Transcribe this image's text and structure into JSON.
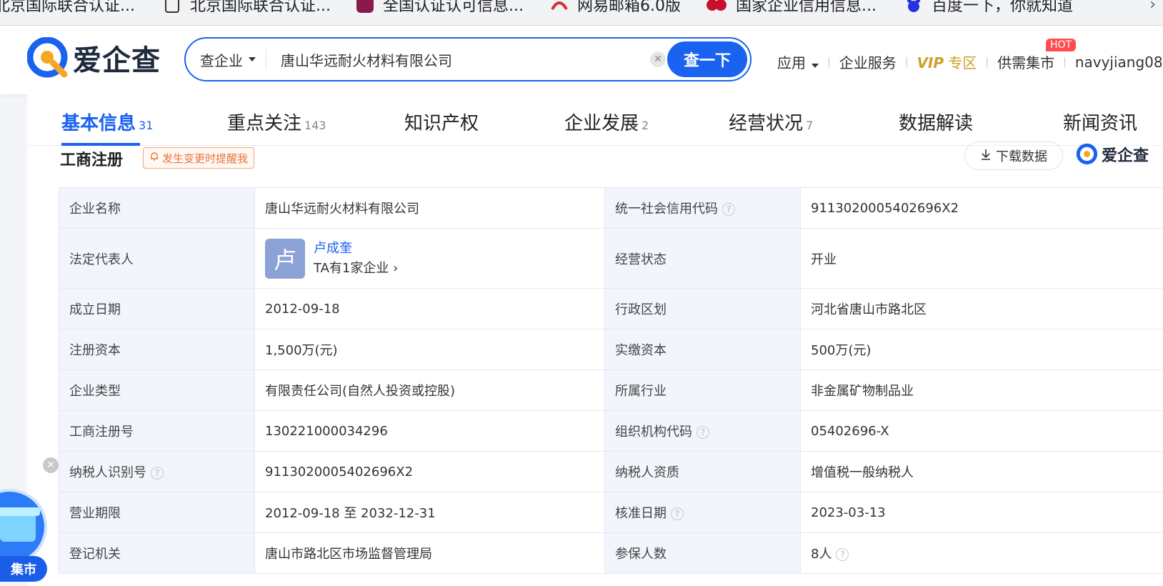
{
  "bookmarks": [
    {
      "label": "北京国际联合认证...",
      "icon": "site-icon"
    },
    {
      "label": "北京国际联合认证...",
      "icon": "page-icon"
    },
    {
      "label": "全国认证认可信息...",
      "icon": "cert-icon"
    },
    {
      "label": "网易邮箱6.0版",
      "icon": "mail-icon"
    },
    {
      "label": "国家企业信用信息...",
      "icon": "gov-icon"
    },
    {
      "label": "百度一下，你就知道",
      "icon": "baidu-icon"
    }
  ],
  "header": {
    "brand": "爱企查",
    "search": {
      "type": "查企业",
      "value": "唐山华远耐火材料有限公司",
      "button": "查一下"
    },
    "nav": {
      "apps": "应用",
      "services": "企业服务",
      "vip": "VIP",
      "vip_zone": "专区",
      "market": "供需集市",
      "hot": "HOT",
      "user": "navyjiang08"
    }
  },
  "tabs": [
    {
      "label": "基本信息",
      "count": "31",
      "active": true
    },
    {
      "label": "重点关注",
      "count": "143"
    },
    {
      "label": "知识产权",
      "count": ""
    },
    {
      "label": "企业发展",
      "count": "2"
    },
    {
      "label": "经营状况",
      "count": "7"
    },
    {
      "label": "数据解读",
      "count": ""
    },
    {
      "label": "新闻资讯",
      "count": ""
    }
  ],
  "section": {
    "title": "工商注册",
    "remind": "发生变更时提醒我",
    "download": "下载数据",
    "brand": "爱企查"
  },
  "legal_rep": {
    "avatar": "卢",
    "name": "卢成奎",
    "sub": "TA有1家企业"
  },
  "rows": [
    {
      "l1": "企业名称",
      "v1": "唐山华远耐火材料有限公司",
      "l2": "统一社会信用代码",
      "v2": "9113020005402696X2"
    },
    {
      "l1": "法定代表人",
      "v1": "",
      "l2": "经营状态",
      "v2": "开业"
    },
    {
      "l1": "成立日期",
      "v1": "2012-09-18",
      "l2": "行政区划",
      "v2": "河北省唐山市路北区"
    },
    {
      "l1": "注册资本",
      "v1": "1,500万(元)",
      "l2": "实缴资本",
      "v2": "500万(元)"
    },
    {
      "l1": "企业类型",
      "v1": "有限责任公司(自然人投资或控股)",
      "l2": "所属行业",
      "v2": "非金属矿物制品业"
    },
    {
      "l1": "工商注册号",
      "v1": "130221000034296",
      "l2": "组织机构代码",
      "v2": "05402696-X"
    },
    {
      "l1": "纳税人识别号",
      "v1": "9113020005402696X2",
      "l2": "纳税人资质",
      "v2": "增值税一般纳税人"
    },
    {
      "l1": "营业期限",
      "v1": "2012-09-18 至 2032-12-31",
      "l2": "核准日期",
      "v2": "2023-03-13"
    },
    {
      "l1": "登记机关",
      "v1": "唐山市路北区市场监督管理局",
      "l2": "参保人数",
      "v2": "8人"
    }
  ],
  "float_widget": {
    "label": "集市"
  },
  "colors": {
    "accent": "#1a62f0",
    "label_bg": "#f2f6fc",
    "vip": "#c9a227",
    "hot": "#ff4d4f"
  }
}
